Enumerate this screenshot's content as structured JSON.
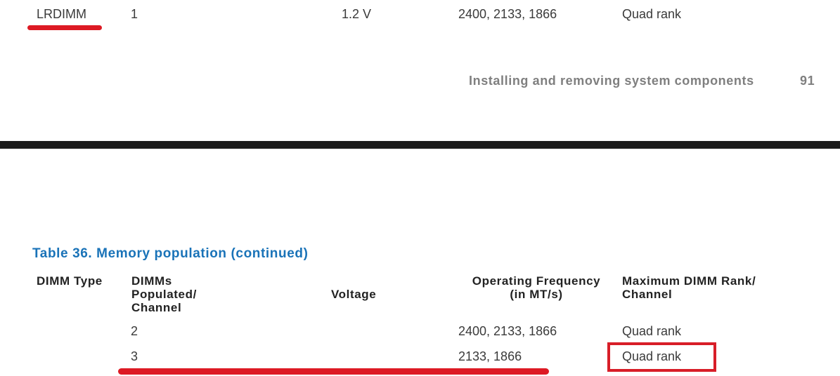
{
  "page_top": {
    "row": {
      "dimm_type": "LRDIMM",
      "dimms_per_channel": "1",
      "voltage": "1.2 V",
      "frequency": "2400, 2133, 1866",
      "max_rank": "Quad rank"
    },
    "footer": {
      "section": "Installing and removing system components",
      "page_number": "91"
    }
  },
  "page_bottom": {
    "table_title": "Table 36. Memory population (continued)",
    "headers": {
      "dimm_type": "DIMM Type",
      "dimms_line1": "DIMMs",
      "dimms_line2": "Populated/",
      "dimms_line3": "Channel",
      "voltage": "Voltage",
      "freq_line1": "Operating Frequency",
      "freq_line2": "(in MT/s)",
      "rank_line1": "Maximum DIMM Rank/",
      "rank_line2": "Channel"
    },
    "rows": [
      {
        "dimms_per_channel": "2",
        "frequency": "2400, 2133, 1866",
        "max_rank": "Quad rank"
      },
      {
        "dimms_per_channel": "3",
        "frequency": "2133, 1866",
        "max_rank": "Quad rank"
      }
    ]
  },
  "annotations": {
    "underline_color": "#dd1a24",
    "box_color": "#d81e28"
  }
}
